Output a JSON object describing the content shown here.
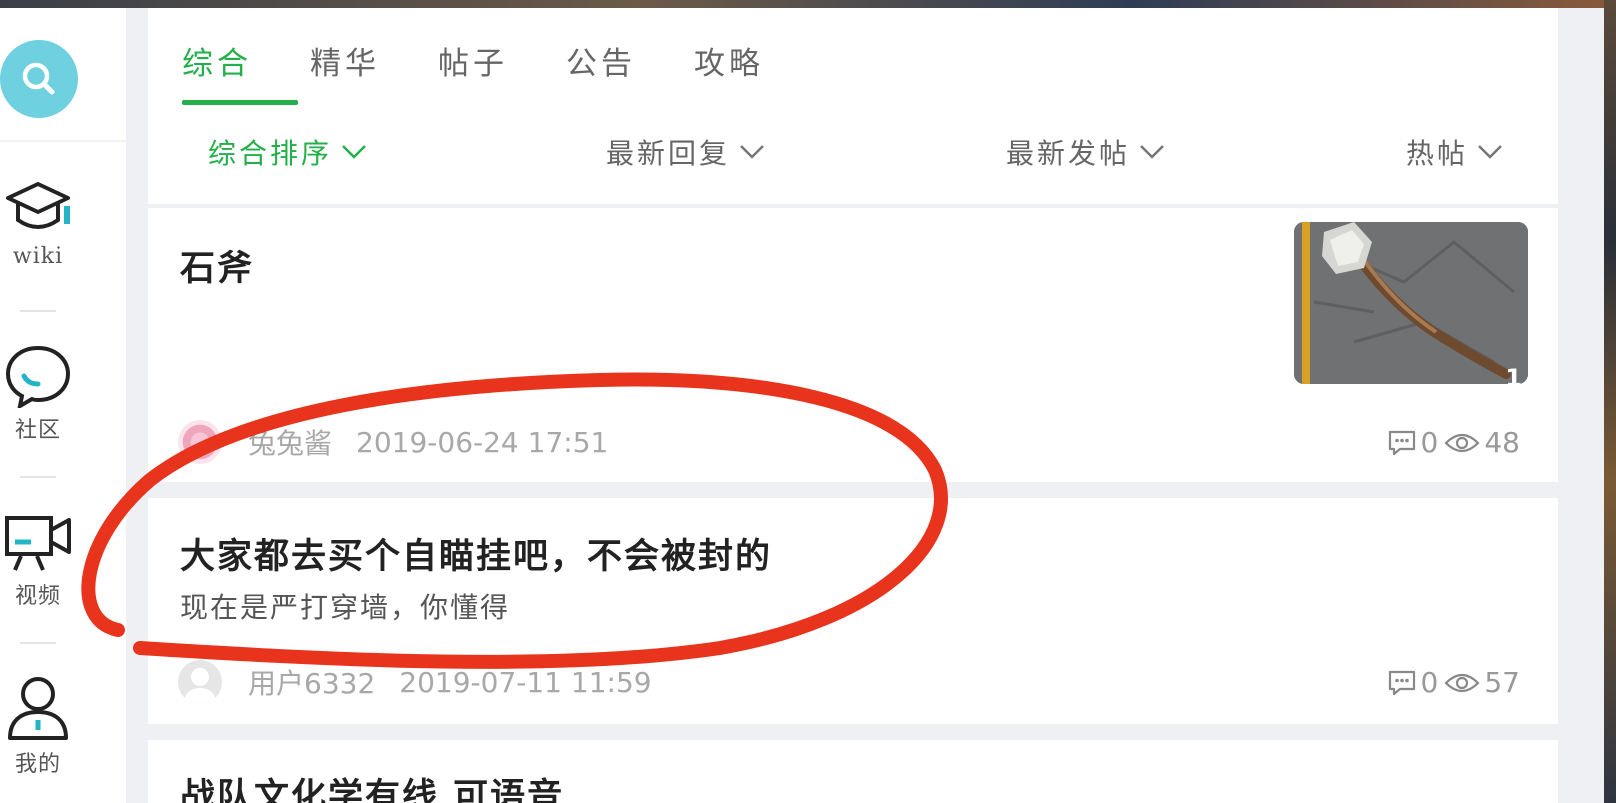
{
  "sidebar": {
    "search_icon": "search-icon",
    "items": [
      {
        "label": "wiki",
        "icon": "graduation-cap-icon"
      },
      {
        "label": "社区",
        "icon": "chat-bubble-icon"
      },
      {
        "label": "视频",
        "icon": "video-camera-icon"
      },
      {
        "label": "我的",
        "icon": "user-icon"
      }
    ]
  },
  "tabs": [
    {
      "label": "综合",
      "active": true
    },
    {
      "label": "精华"
    },
    {
      "label": "帖子"
    },
    {
      "label": "公告"
    },
    {
      "label": "攻略"
    }
  ],
  "sorts": [
    {
      "label": "综合排序",
      "active": true
    },
    {
      "label": "最新回复"
    },
    {
      "label": "最新发帖"
    },
    {
      "label": "热帖"
    }
  ],
  "posts": [
    {
      "title": "石斧",
      "subtitle": "",
      "author": "兔兔酱",
      "time": "2019-06-24 17:51",
      "comments": "0",
      "views": "48",
      "thumbnail_badge": "1"
    },
    {
      "title": "大家都去买个自瞄挂吧，不会被封的",
      "subtitle": "现在是严打穿墙，你懂得",
      "author": "用户6332",
      "time": "2019-07-11 11:59",
      "comments": "0",
      "views": "57"
    },
    {
      "title": "战队文化学有线 可语音"
    }
  ],
  "colors": {
    "accent": "#23b04a",
    "search_button": "#6fd0e0",
    "annotation": "#e8341c"
  }
}
